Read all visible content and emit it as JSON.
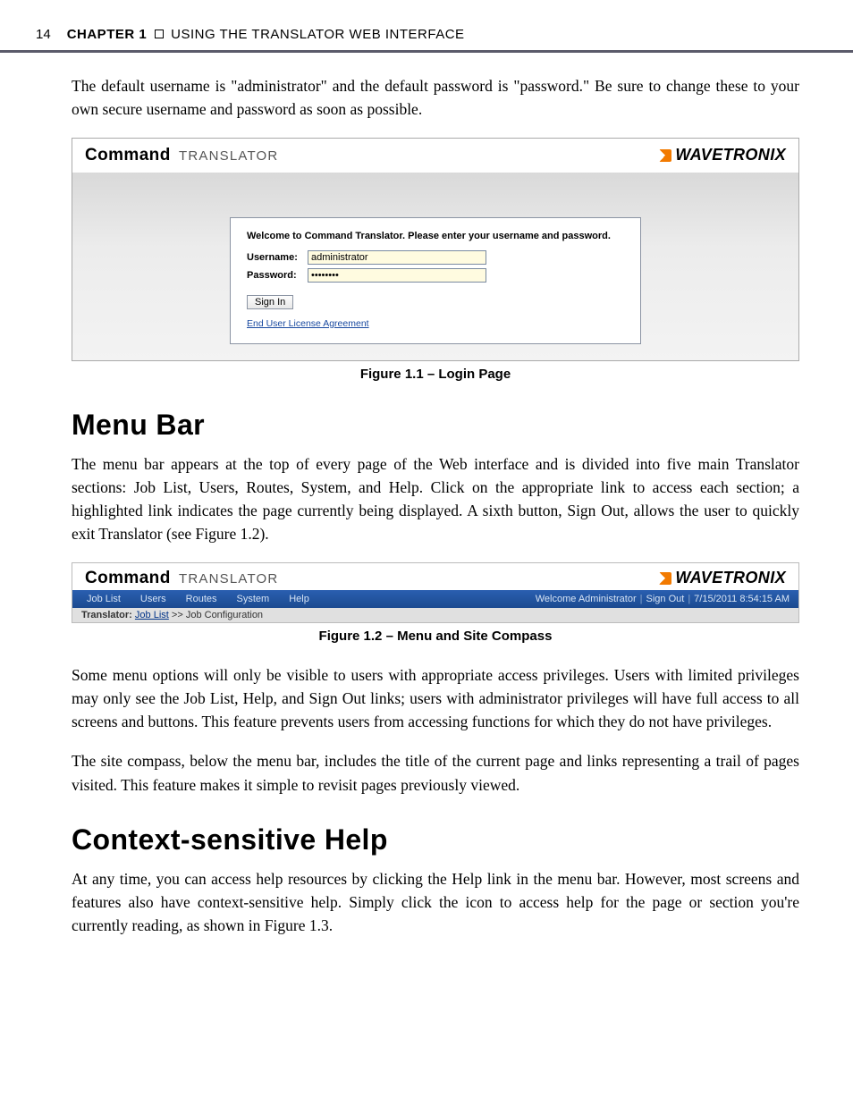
{
  "header": {
    "page_number": "14",
    "chapter_label": "CHAPTER 1",
    "chapter_title": "USING THE TRANSLATOR WEB INTERFACE"
  },
  "paragraphs": {
    "intro": "The default username is \"administrator\" and the default password is \"password.\" Be sure to change these to your own secure username and password as soon as possible.",
    "menu_bar": "The menu bar appears at the top of every page of the Web interface and is divided into five main Translator sections: Job List, Users, Routes, System, and Help. Click on the appropriate link to access each section; a highlighted link indicates the page currently being displayed. A sixth button, Sign Out, allows the user to quickly exit Translator (see Figure 1.2).",
    "menu_access": "Some menu options will only be visible to users with appropriate access privileges. Users with limited privileges may only see the Job List, Help, and Sign Out links; users with administrator privileges will have full access to all screens and buttons. This feature prevents users from accessing functions for which they do not have privileges.",
    "site_compass": "The site compass, below the menu bar, includes the title of the current page and links representing a trail of pages visited. This feature makes it simple to revisit pages previously viewed.",
    "help": "At any time, you can access help resources by clicking the Help link in the menu bar. However, most screens and features also have context-sensitive help. Simply click the  icon to access help for the page or section you're currently reading, as shown in Figure 1.3."
  },
  "sections": {
    "menu_bar_heading": "Menu Bar",
    "help_heading": "Context-sensitive Help"
  },
  "figure11": {
    "brand_bold": "Command",
    "brand_light": "TRANSLATOR",
    "vendor": "WAVETRONIX",
    "welcome": "Welcome to Command Translator. Please enter your username and password.",
    "username_label": "Username:",
    "username_value": "administrator",
    "password_label": "Password:",
    "password_value": "••••••••",
    "signin_label": "Sign In",
    "eula_label": "End User License Agreement",
    "caption": "Figure 1.1 – Login Page"
  },
  "figure12": {
    "brand_bold": "Command",
    "brand_light": "TRANSLATOR",
    "vendor": "WAVETRONIX",
    "menu_items": [
      "Job List",
      "Users",
      "Routes",
      "System",
      "Help"
    ],
    "status_welcome": "Welcome Administrator",
    "status_signout": "Sign Out",
    "status_timestamp": "7/15/2011 8:54:15 AM",
    "breadcrumb_app": "Translator:",
    "breadcrumb_link": "Job List",
    "breadcrumb_sep": ">>",
    "breadcrumb_current": "Job Configuration",
    "caption": "Figure 1.2 – Menu and Site Compass"
  }
}
